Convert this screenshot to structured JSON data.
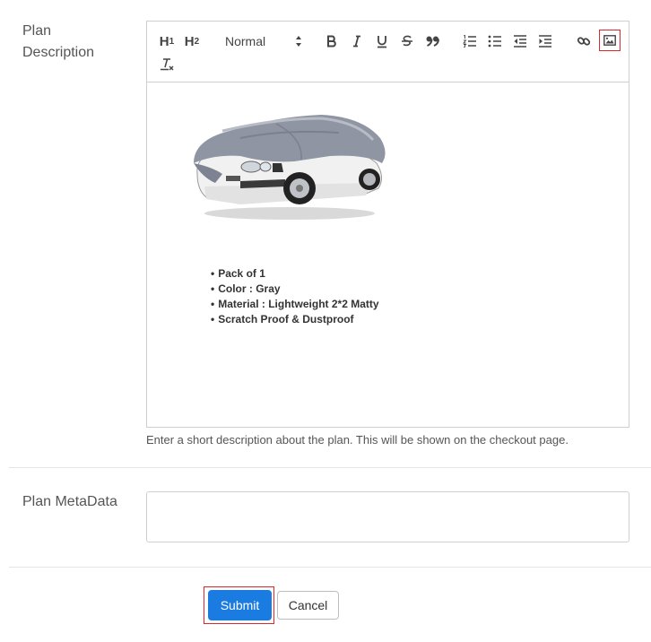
{
  "form": {
    "plan_description_label": "Plan Description",
    "plan_metadata_label": "Plan MetaData",
    "help_text": "Enter a short description about the plan. This will be shown on the checkout page.",
    "metadata_value": ""
  },
  "toolbar": {
    "h1": "H",
    "h1_sub": "1",
    "h2": "H",
    "h2_sub": "2",
    "format_select": "Normal",
    "icons": [
      "bold-icon",
      "italic-icon",
      "underline-icon",
      "strikethrough-icon",
      "blockquote-icon",
      "ordered-list-icon",
      "bullet-list-icon",
      "outdent-icon",
      "indent-icon",
      "link-icon",
      "image-icon",
      "clear-format-icon"
    ]
  },
  "description": {
    "bullets": [
      "Pack of 1",
      "Color : Gray",
      "Material : Lightweight 2*2 Matty",
      "Scratch Proof & Dustproof"
    ]
  },
  "buttons": {
    "submit": "Submit",
    "cancel": "Cancel"
  },
  "colors": {
    "primary": "#1a7be0",
    "highlight": "#e0262b"
  }
}
